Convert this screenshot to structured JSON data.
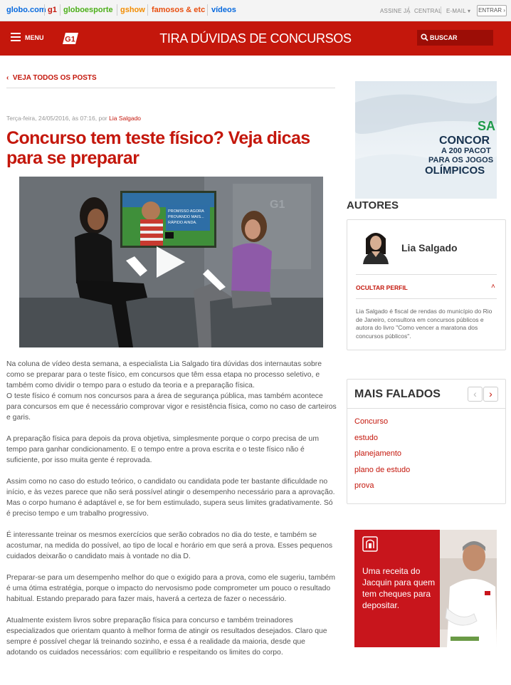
{
  "globobar": {
    "links": [
      {
        "label": "globo.com",
        "color": "#0669de"
      },
      {
        "label": "g1",
        "color": "#c4170c"
      },
      {
        "label": "globoesporte",
        "color": "#4caf19"
      },
      {
        "label": "gshow",
        "color": "#f28c00"
      },
      {
        "label": "famosos & etc",
        "color": "#e84e0f"
      },
      {
        "label": "vídeos",
        "color": "#0669de"
      }
    ],
    "assine": "ASSINE JÁ",
    "central": "CENTRAL",
    "email": "E-MAIL",
    "entrar": "ENTRAR"
  },
  "header": {
    "menu_label": "MENU",
    "logo": "G1",
    "title": "TIRA DÚVIDAS DE CONCURSOS",
    "search_label": "BUSCAR",
    "bg_color": "#c4170c"
  },
  "post": {
    "back_label": "VEJA TODOS OS POSTS",
    "meta_prefix": "Terça-feira, 24/05/2016, às 07:16, por ",
    "author": "Lia Salgado",
    "headline": "Concurso tem teste físico? Veja dicas para se preparar",
    "video_logo": "G1",
    "video_screen_text": "PROMISSO AGORA\nPROVANDO MAIS...\nRÁPIDO AINDA.",
    "paragraphs": [
      "Na coluna de vídeo desta semana, a especialista Lia Salgado tira dúvidas dos internautas sobre como se preparar para o teste físico, em concursos que têm essa etapa no processo seletivo, e também como dividir o tempo para o estudo da teoria e a preparação física.\nO teste físico é comum nos concursos para a área de segurança pública, mas também acontece para concursos em que é necessário comprovar vigor e resistência física, como no caso de carteiros e garis.",
      "A preparação física para depois da prova objetiva, simplesmente porque o corpo precisa de um tempo para ganhar condicionamento. E o tempo entre a prova escrita e o teste físico não é suficiente, por isso muita gente é reprovada.",
      "Assim como no caso do estudo teórico, o candidato ou candidata pode ter bastante dificuldade no início, e às vezes parece que não será possível atingir o desempenho necessário para a aprovação. Mas o corpo humano é adaptável e, se for bem estimulado, supera seus limites gradativamente. Só é preciso tempo e um trabalho progressivo.",
      "É interessante treinar os mesmos exercícios que serão cobrados no dia do teste, e também se acostumar, na medida do possível, ao tipo de local e horário em que será a prova. Esses pequenos cuidados deixarão o candidato mais à vontade no dia D.",
      "Preparar-se para um desempenho melhor do que o exigido para a prova, como ele sugeriu, também é uma ótima estratégia, porque o impacto do nervosismo pode comprometer um pouco o resultado habitual. Estando preparado para fazer mais, haverá a certeza de fazer o necessário.",
      "Atualmente existem livros sobre preparação física para concurso e também treinadores especializados que orientam quanto à melhor forma de atingir os resultados desejados. Claro que sempre é possível chegar lá treinando sozinho, e essa é a realidade da maioria, desde que adotando os cuidados necessários: com equilíbrio e respeitando os limites do corpo."
    ]
  },
  "sidebar": {
    "ad_top": {
      "lines": [
        "SA",
        "CONCOR",
        "A 200 PACOT",
        "PARA OS JOGOS",
        "OLÍMPICOS"
      ]
    },
    "authors_title": "AUTORES",
    "author_card": {
      "name": "Lia Salgado",
      "toggle_label": "OCULTAR PERFIL",
      "bio": "Lia Salgado é fiscal de rendas do município do Rio de Janeiro, consultora em concursos públicos e autora do livro \"Como vencer a maratona dos concursos públicos\"."
    },
    "most_talked": {
      "title": "MAIS FALADOS",
      "prev": "‹",
      "next": "›",
      "items": [
        "Concurso",
        "estudo",
        "planejamento",
        "plano de estudo",
        "prova"
      ]
    },
    "ad_bottom": {
      "text": "Uma receita do Jacquin para quem tem cheques para depositar."
    }
  }
}
